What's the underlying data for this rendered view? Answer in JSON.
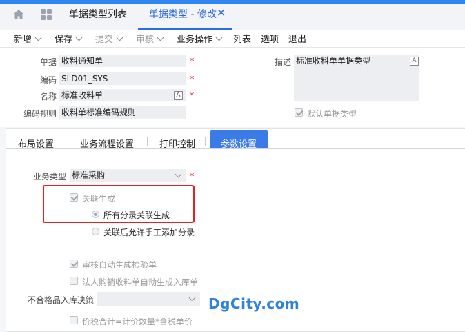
{
  "tabs": {
    "list_tab": "单据类型列表",
    "active_tab": "单据类型 - 修改",
    "close_symbol": "✕"
  },
  "toolbar": {
    "items": [
      "新增",
      "保存",
      "提交",
      "审核",
      "业务操作",
      "列表",
      "选项",
      "退出"
    ]
  },
  "header": {
    "bill_label": "单据",
    "bill_value": "收料通知单",
    "code_label": "编码",
    "code_value": "SLD01_SYS",
    "name_label": "名称",
    "name_value": "标准收料单",
    "rule_label": "编码规则",
    "rule_value": "收料单标准编码规则",
    "desc_label": "描述",
    "desc_value": "标准收料单单据类型",
    "default_label": "默认单据类型",
    "lang_icon": "A",
    "required_mark": "*"
  },
  "section_tabs": [
    "布局设置",
    "业务流程设置",
    "打印控制",
    "参数设置"
  ],
  "params": {
    "biz_type_label": "业务类型",
    "biz_type_value": "标准采购",
    "assoc_gen": "关联生成",
    "radio_all": "所有分录关联生成",
    "radio_manual": "关联后允许手工添加分录",
    "audit_gen": "审核自动生成检验单",
    "legal_gen": "法人购销收料单自动生成入库单",
    "reject_label": "不合格品入库决策",
    "price_total": "价税合计=计价数量*含税单价"
  },
  "watermark": "DgCity.com",
  "colors": {
    "accent": "#2e6be0",
    "active_tab_bg": "#3b7be8",
    "required": "#e0262c",
    "highlight": "#e42020"
  }
}
